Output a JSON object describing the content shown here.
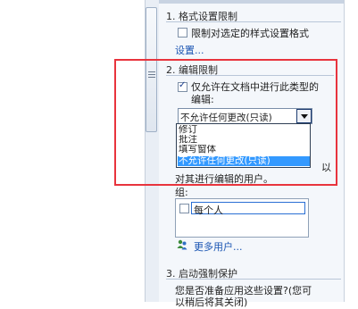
{
  "section1": {
    "title": "1. 格式设置限制",
    "checkbox_label": "限制对选定的样式设置格式",
    "settings_link": "设置..."
  },
  "section2": {
    "title": "2. 编辑限制",
    "checkbox_label_line1": "仅允许在文档中进行此类型的",
    "checkbox_label_line2": "编辑:",
    "checkbox_checked": true,
    "select_value": "不允许任何更改(只读)",
    "options": [
      "修订",
      "批注",
      "填写窗体",
      "不允许任何更改(只读)"
    ],
    "selected_option_index": 3,
    "hint_line1_fragment": "以",
    "hint_line2": "对其进行编辑的用户。",
    "group_label": "组:",
    "users": [
      {
        "label": "每个人",
        "checked": false
      }
    ],
    "more_users_link": "更多用户..."
  },
  "section3": {
    "title": "3. 启动强制保护",
    "text_line1": "您是否准备应用这些设置?(您可",
    "text_line2": "以稍后将其关闭)"
  },
  "colors": {
    "highlight_box": "#e8343d",
    "selection": "#3399ff",
    "link": "#1a55b3"
  }
}
